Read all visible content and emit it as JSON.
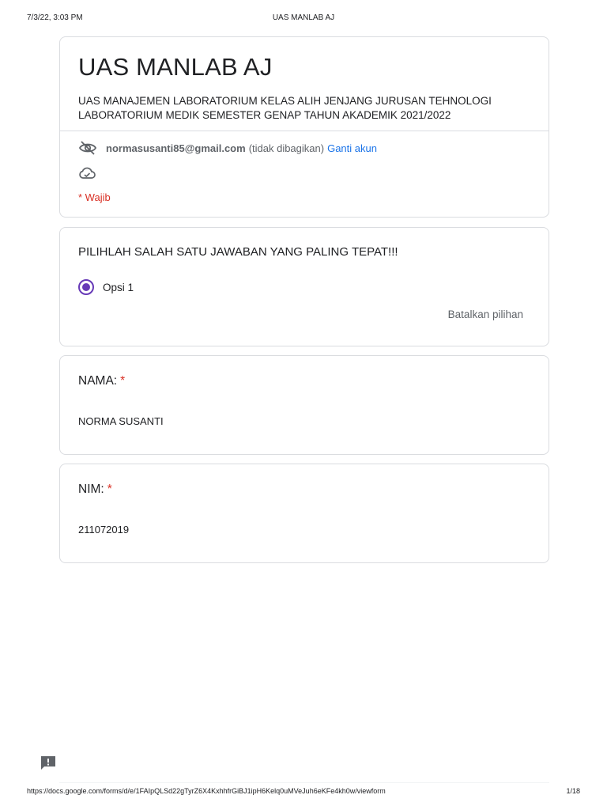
{
  "print_header": {
    "date": "7/3/22, 3:03 PM",
    "title": "UAS MANLAB AJ"
  },
  "form": {
    "title": "UAS MANLAB AJ",
    "description_line1": "UAS MANAJEMEN LABORATORIUM KELAS ALIH JENJANG JURUSAN TEHNOLOGI",
    "description_line2": "LABORATORIUM MEDIK SEMESTER GENAP TAHUN AKADEMIK 2021/2022",
    "account_email": "normasusanti85@gmail.com",
    "not_shared": "(tidak dibagikan)",
    "switch_account": "Ganti akun",
    "required_note": "* Wajib",
    "icons": [
      "eye-off-icon",
      "cloud-done-icon",
      "feedback-icon"
    ]
  },
  "questions": [
    {
      "text": "PILIHLAH SALAH SATU JAWABAN YANG PALING TEPAT!!!",
      "option_label": "Opsi 1",
      "selected": true,
      "clear_label": "Batalkan pilihan"
    },
    {
      "label": "NAMA:",
      "required_mark": "*",
      "answer": "NORMA SUSANTI"
    },
    {
      "label": "NIM:",
      "required_mark": "*",
      "answer": "211072019"
    }
  ],
  "colors": {
    "accent": "#673ab7",
    "required": "#d93025",
    "link": "#1a73e8",
    "border": "#dadce0"
  },
  "print_footer": {
    "url": "https://docs.google.com/forms/d/e/1FAIpQLSd22gTyrZ6X4KxhhfrGiBJ1ipH6Kelq0uMVeJuh6eKFe4kh0w/viewform",
    "page": "1/18"
  }
}
